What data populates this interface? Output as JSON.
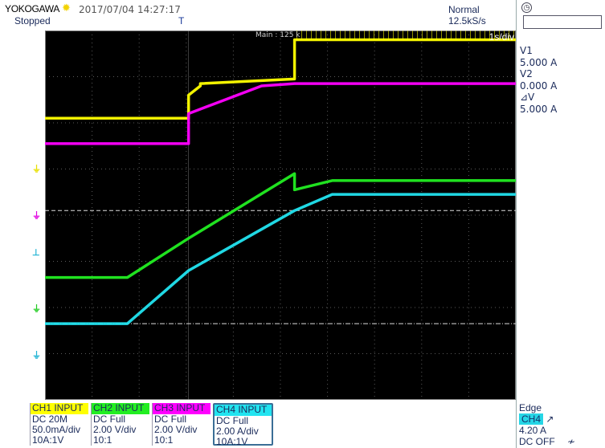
{
  "header": {
    "brand": "YOKOGAWA",
    "datetime": "2017/07/04 14:27:17",
    "status": "Stopped",
    "trigger_marker": "T",
    "mode": "Normal",
    "sample_rate": "12.5kS/s"
  },
  "screen": {
    "main_label": "Main : 125 k",
    "timebase": "1s/div"
  },
  "cursors": {
    "v1_label": "V1",
    "v1_value": "5.000 A",
    "v2_label": "V2",
    "v2_value": "0.000 A",
    "dv_label": "⊿V",
    "dv_value": "5.000 A"
  },
  "channels": [
    {
      "header": "CH1 INPUT",
      "coupling": "DC 20M",
      "scale": "50.0mA/div",
      "probe": "10A:1V",
      "color": "#ffff00"
    },
    {
      "header": "CH2 INPUT",
      "coupling": "DC Full",
      "scale": "2.00 V/div",
      "probe": "10:1",
      "color": "#22ee22"
    },
    {
      "header": "CH3 INPUT",
      "coupling": "DC Full",
      "scale": "2.00 V/div",
      "probe": "10:1",
      "color": "#ff00ff"
    },
    {
      "header": "CH4 INPUT",
      "coupling": "DC Full",
      "scale": "2.00 A/div",
      "probe": "10A:1V",
      "color": "#22e4f0"
    }
  ],
  "trigger": {
    "type": "Edge",
    "source": "CH4",
    "level": "4.20 A",
    "coupling": "DC OFF"
  },
  "icons": [
    "clock-icon",
    "sun-icon",
    "trigger-rise-icon",
    "filter-icon"
  ],
  "chart_data": {
    "type": "line",
    "x_divisions": 10,
    "y_divisions": 8,
    "grid": true,
    "series": [
      {
        "name": "CH1",
        "color": "#ffff00",
        "x": [
          0,
          3.05,
          3.05,
          3.3,
          3.3,
          5.3,
          5.3,
          10
        ],
        "y": [
          2.1,
          2.1,
          2.6,
          2.8,
          2.85,
          2.95,
          3.8,
          3.8
        ]
      },
      {
        "name": "CH3",
        "color": "#ff00ff",
        "x": [
          0,
          3.05,
          3.05,
          4.6,
          5.3,
          10
        ],
        "y": [
          1.55,
          1.55,
          2.2,
          2.8,
          2.85,
          2.85
        ]
      },
      {
        "name": "CH2",
        "color": "#22ee22",
        "x": [
          0,
          1.75,
          3.05,
          5.3,
          5.3,
          6.1,
          10
        ],
        "y": [
          -1.35,
          -1.35,
          -0.5,
          0.9,
          0.55,
          0.75,
          0.75
        ]
      },
      {
        "name": "CH4",
        "color": "#22e4f0",
        "x": [
          0,
          1.75,
          3.05,
          5.3,
          6.1,
          10
        ],
        "y": [
          -2.35,
          -2.35,
          -1.2,
          0.1,
          0.45,
          0.45
        ]
      }
    ]
  }
}
